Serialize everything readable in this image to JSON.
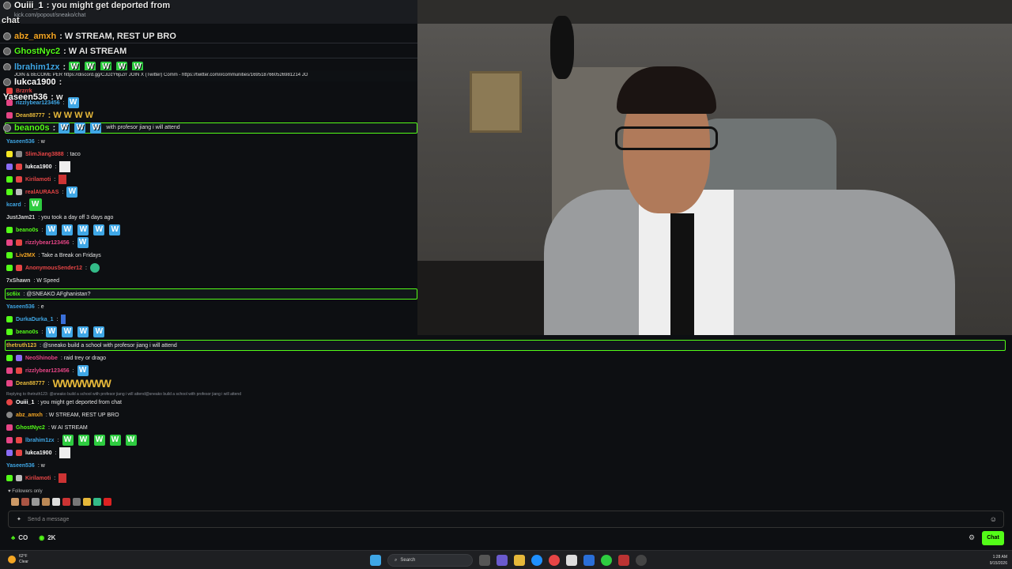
{
  "popout": {
    "url": "kick.com/popout/sneako/chat"
  },
  "overlay": [
    {
      "user": "Ouiii_1",
      "text": ": you might get deported from",
      "color": "#ffffff"
    },
    {
      "user": "",
      "text": "chat",
      "color": "#ffffff"
    },
    {
      "user": "abz_amxh",
      "text": ": W STREAM, REST UP BRO",
      "color": "#f5a623"
    },
    {
      "user": "GhostNyc2",
      "text": ": W AI STREAM",
      "color": "#53fc18"
    },
    {
      "user": "lbrahim1zx",
      "text": ":",
      "color": "#3fa7e6"
    },
    {
      "user": "lukca1900",
      "text": ":",
      "color": "#ffffff"
    },
    {
      "user": "Yaseen536",
      "text": ": w",
      "color": "#ffffff"
    },
    {
      "user": "beano0s",
      "text": ":",
      "color": "#53fc18"
    }
  ],
  "pinned": {
    "text": "JOIN & BECOME PER https://discord.gg/CJDzY6pZrr  JOIN X (Twitter) Comm - https://twitter.com/i/communities/1695187660526981214  JO"
  },
  "pinned_overlap": [
    {
      "user": "Brzrrk",
      "color": "#e64545"
    },
    {
      "user": "rizzlybear123456",
      "color": "#3fa7e6",
      "text": ":"
    },
    {
      "user": "Dean88777",
      "color": "#e6b83a",
      "text": ": W W W W"
    }
  ],
  "highlight_top": {
    "text": "with profesor jiang i will attend"
  },
  "messages": [
    {
      "user": "Yaseen536",
      "text": ": w",
      "color": "#3fa7e6"
    },
    {
      "user": "SlimJiang3888",
      "text": ": taco",
      "color": "#e64545"
    },
    {
      "user": "lukca1900",
      "text": ":",
      "color": "#ffffff"
    },
    {
      "user": "Kirilamoti",
      "text": ":",
      "color": "#e64545"
    },
    {
      "user": "realAURAAS",
      "text": ":",
      "color": "#e64545"
    },
    {
      "user": "kcard",
      "text": ":",
      "color": "#3fa7e6"
    },
    {
      "user": "JustJam21",
      "text": ": you took a day off 3 days ago",
      "color": "#cfcfcf"
    },
    {
      "user": "beano0s",
      "text": ":",
      "color": "#53fc18"
    },
    {
      "user": "rizzlybear123456",
      "text": ":",
      "color": "#e64585"
    },
    {
      "user": "Liv2MX",
      "text": ": Take a Break on Fridays",
      "color": "#f5a623"
    },
    {
      "user": "AnonymousSender12",
      "text": ":",
      "color": "#e64545"
    },
    {
      "user": "7xShawn",
      "text": ": W Speed",
      "color": "#cfcfcf"
    },
    {
      "user": "sc6ix",
      "text": ": @SNEAKO AFghanistan?",
      "color": "#53fc18"
    },
    {
      "user": "Yaseen536",
      "text": ": e",
      "color": "#3fa7e6"
    },
    {
      "user": "DurkaDurka_1",
      "text": ":",
      "color": "#3fa7e6"
    },
    {
      "user": "beano0s",
      "text": ":",
      "color": "#53fc18"
    },
    {
      "user": "thetruth123",
      "text": ": @sneako build a school with profesor jiang i will attend",
      "color": "#e6b83a"
    },
    {
      "user": "NeoShinobe",
      "text": ": raid trey or drago",
      "color": "#e64585"
    },
    {
      "user": "rizzlybear123456",
      "text": ":",
      "color": "#e64585"
    },
    {
      "user": "Dean88777",
      "text": ":",
      "color": "#e6b83a"
    },
    {
      "user": "Ouiii_1",
      "text": ": you might get deported from chat",
      "color": "#ffffff"
    },
    {
      "user": "abz_amxh",
      "text": ": W STREAM, REST UP BRO",
      "color": "#f5a623"
    },
    {
      "user": "GhostNyc2",
      "text": ": W AI STREAM",
      "color": "#53fc18"
    },
    {
      "user": "lbrahim1zx",
      "text": ":",
      "color": "#3fa7e6"
    },
    {
      "user": "lukca1900",
      "text": ":",
      "color": "#ffffff"
    },
    {
      "user": "Yaseen536",
      "text": ": w",
      "color": "#3fa7e6"
    },
    {
      "user": "Kirilamoti",
      "text": ":",
      "color": "#e64545"
    }
  ],
  "reply_line": "Replying to thetruth123: @sneako build a school with profesor jiang i will attend@sneako build a school with profesor jiang i will attend",
  "followers_only": "Followers only",
  "input": {
    "placeholder": "Send a message"
  },
  "stats": {
    "combo": "CO",
    "viewers": "2K"
  },
  "chat_button": "Chat",
  "taskbar": {
    "weather_temp": "62°F",
    "weather_cond": "Clear",
    "search": "Search",
    "time": "1:28 AM",
    "date": "9/15/2026"
  },
  "colors": {
    "accent": "#53fc18"
  }
}
